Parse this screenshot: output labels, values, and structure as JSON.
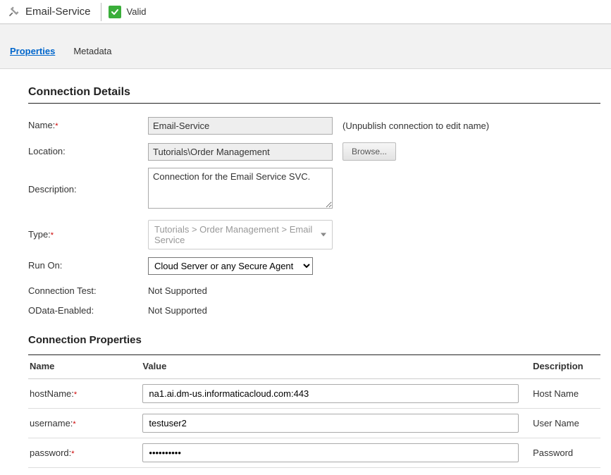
{
  "header": {
    "title": "Email-Service",
    "valid_label": "Valid"
  },
  "tabs": {
    "properties": "Properties",
    "metadata": "Metadata"
  },
  "details": {
    "section_title": "Connection Details",
    "name_label": "Name:",
    "name_value": "Email-Service",
    "name_hint": "(Unpublish connection to edit name)",
    "location_label": "Location:",
    "location_value": "Tutorials\\Order Management",
    "browse_label": "Browse...",
    "description_label": "Description:",
    "description_value": "Connection for the Email Service SVC.",
    "type_label": "Type:",
    "type_value": "Tutorials > Order Management > Email Service",
    "runon_label": "Run On:",
    "runon_value": "Cloud Server or any Secure Agent",
    "conntest_label": "Connection Test:",
    "conntest_value": "Not Supported",
    "odata_label": "OData-Enabled:",
    "odata_value": "Not Supported"
  },
  "props": {
    "section_title": "Connection Properties",
    "headers": {
      "name": "Name",
      "value": "Value",
      "desc": "Description"
    },
    "rows": [
      {
        "name": "hostName:",
        "value": "na1.ai.dm-us.informaticacloud.com:443",
        "desc": "Host Name",
        "type": "text"
      },
      {
        "name": "username:",
        "value": "testuser2",
        "desc": "User Name",
        "type": "text"
      },
      {
        "name": "password:",
        "value": "••••••••••",
        "desc": "Password",
        "type": "password"
      }
    ]
  }
}
